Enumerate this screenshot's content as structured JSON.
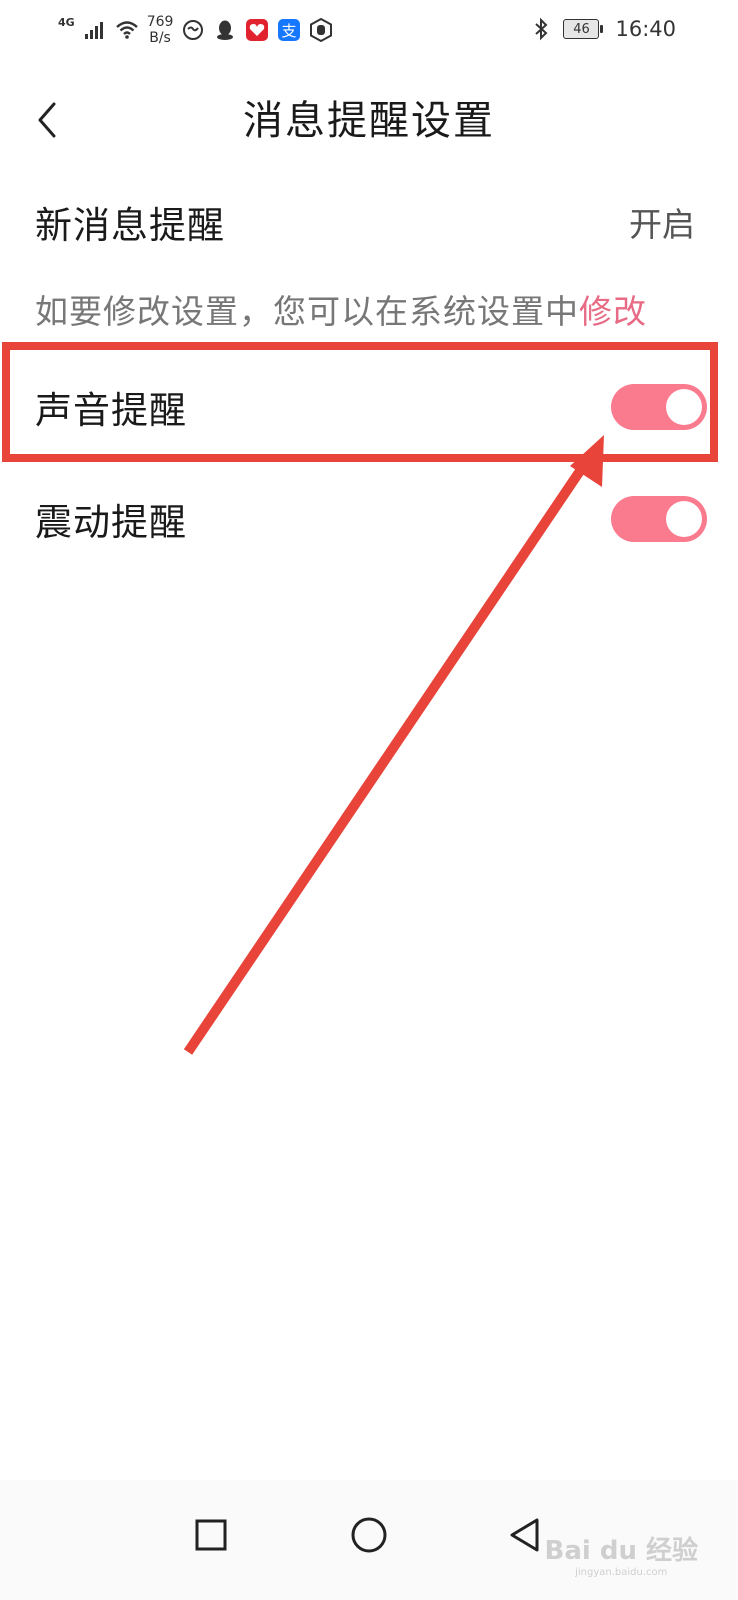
{
  "status_bar": {
    "network": "4G",
    "speed_value": "769",
    "speed_unit": "B/s",
    "battery": "46",
    "time": "16:40"
  },
  "header": {
    "title": "消息提醒设置"
  },
  "settings": {
    "new_message": {
      "label": "新消息提醒",
      "value": "开启"
    },
    "hint_text": "如要修改设置，您可以在系统设置中",
    "hint_link": "修改",
    "sound": {
      "label": "声音提醒",
      "enabled": true
    },
    "vibrate": {
      "label": "震动提醒",
      "enabled": true
    }
  },
  "colors": {
    "accent": "#fb7b8e",
    "annotation": "#e8443a",
    "link": "#e86b86"
  },
  "watermark": {
    "brand": "Bai du 经验",
    "url": "jingyan.baidu.com"
  }
}
